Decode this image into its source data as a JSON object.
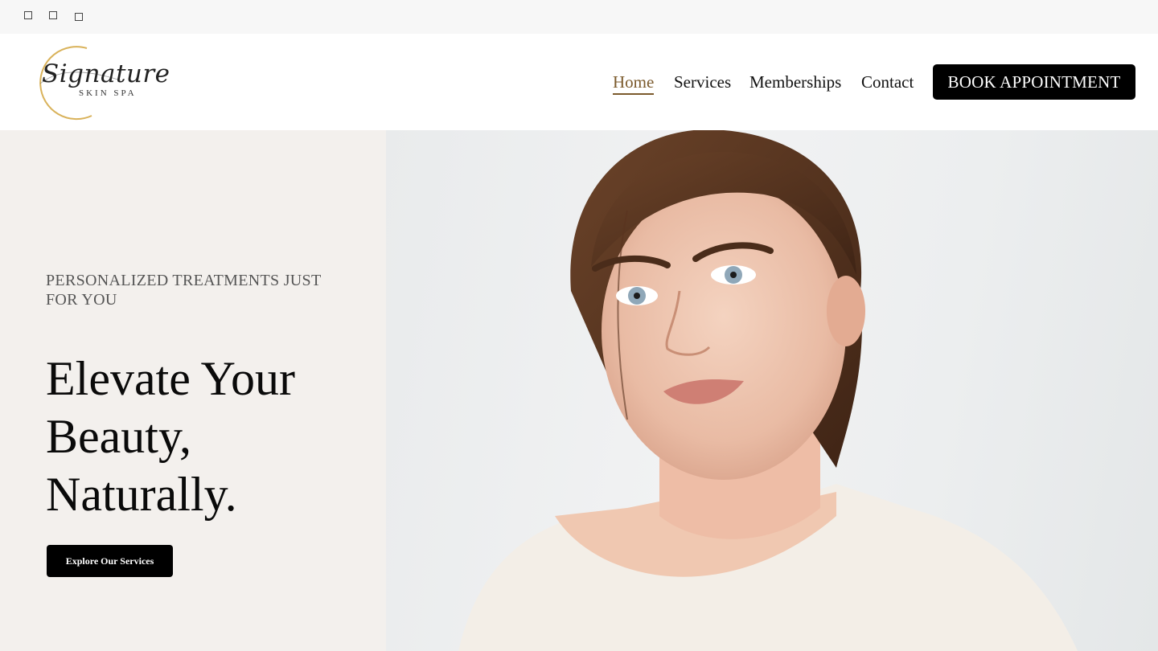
{
  "topbar": {
    "icons": [
      "square-icon",
      "square-icon",
      "square-icon"
    ]
  },
  "brand": {
    "script": "Signature",
    "subtitle": "SKIN SPA",
    "accent_color": "#d9b25a"
  },
  "nav": {
    "items": [
      {
        "label": "Home",
        "active": true
      },
      {
        "label": "Services",
        "active": false
      },
      {
        "label": "Memberships",
        "active": false
      },
      {
        "label": "Contact",
        "active": false
      }
    ],
    "active_color": "#7b5a2c",
    "cta_label": "BOOK APPOINTMENT"
  },
  "hero": {
    "eyebrow": "PERSONALIZED TREATMENTS JUST FOR YOU",
    "headline": "Elevate Your Beauty, Naturally.",
    "cta_label": "Explore Our Services",
    "panel_color": "#f3f0ed",
    "image_icon": "portrait-photo"
  }
}
